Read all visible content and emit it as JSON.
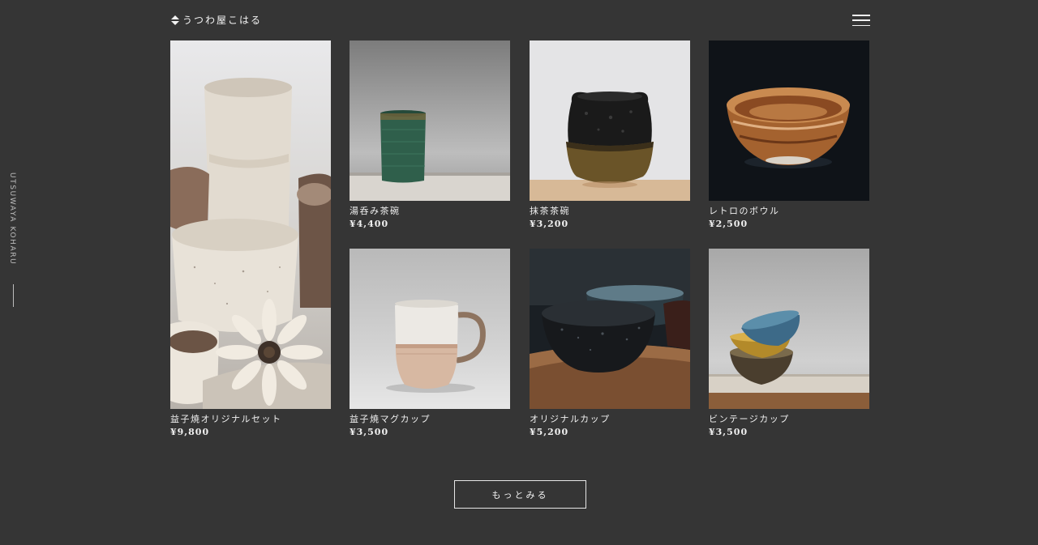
{
  "header": {
    "logo_text": "うつわ屋こはる",
    "menu_icon": "hamburger-menu-icon"
  },
  "side": {
    "brand_vertical": "UTSUWAYA KOHARU"
  },
  "products": [
    {
      "name": "益子焼オリジナルセット",
      "price": "¥9,800"
    },
    {
      "name": "湯呑み茶碗",
      "price": "¥4,400"
    },
    {
      "name": "抹茶茶碗",
      "price": "¥3,200"
    },
    {
      "name": "レトロのボウル",
      "price": "¥2,500"
    },
    {
      "name": "益子焼マグカップ",
      "price": "¥3,500"
    },
    {
      "name": "オリジナルカップ",
      "price": "¥5,200"
    },
    {
      "name": "ビンテージカップ",
      "price": "¥3,500"
    }
  ],
  "more_button": {
    "label": "もっとみる"
  },
  "colors": {
    "background": "#353535",
    "text": "#f0f0f0",
    "muted": "#bdbdbd"
  }
}
